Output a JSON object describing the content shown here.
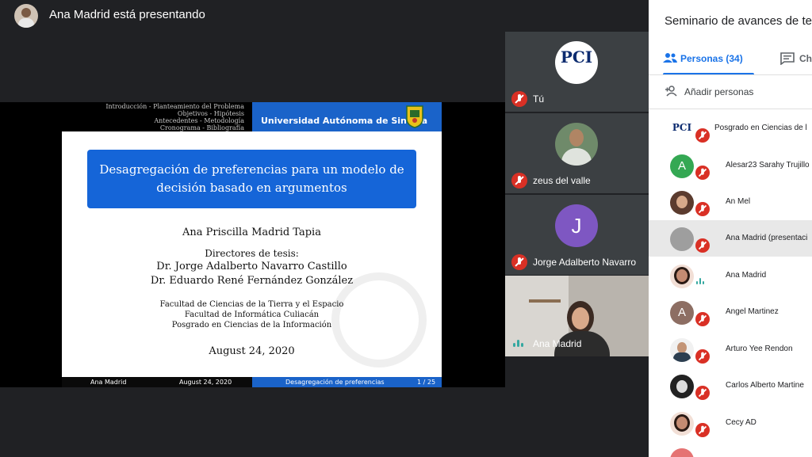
{
  "presenter": {
    "title": "Ana Madrid está presentando"
  },
  "slide": {
    "nav_lines": [
      "Introducción - Planteamiento del Problema",
      "Objetivos - Hipótesis",
      "Antecedentes - Metodología",
      "Cronograma - Bibliografía"
    ],
    "header_university": "Universidad Autónoma de Sinaloa",
    "title_line1": "Desagregación de preferencias para un modelo de",
    "title_line2": "decisión basado en argumentos",
    "author": "Ana Priscilla Madrid Tapia",
    "directors_label": "Directores de tesis:",
    "director1": "Dr. Jorge Adalberto Navarro Castillo",
    "director2": "Dr. Eduardo René Fernández González",
    "faculty1": "Facultad de Ciencias de la Tierra y el Espacio",
    "faculty2": "Facultad de Informática Culiacán",
    "faculty3": "Posgrado en Ciencias de la Información",
    "date": "August 24, 2020",
    "footer_author": "Ana Madrid",
    "footer_date": "August 24, 2020",
    "footer_title": "Desagregación de preferencias",
    "footer_page": "1 / 25"
  },
  "tiles": [
    {
      "name": "Tú",
      "avatar": "PCI"
    },
    {
      "name": "zeus del valle"
    },
    {
      "name": "Jorge Adalberto Navarro",
      "initial": "J"
    },
    {
      "name": "Ana Madrid"
    }
  ],
  "panel": {
    "title": "Seminario de avances de te",
    "tab_people": "Personas (34)",
    "tab_chat": "Ch",
    "add_people": "Añadir personas",
    "people": [
      {
        "name": "Posgrado en Ciencias de l",
        "avatar": "PCI"
      },
      {
        "name": "Alesar23 Sarahy Trujillo",
        "initial": "A"
      },
      {
        "name": "An Mel"
      },
      {
        "name": "Ana Madrid (presentaci"
      },
      {
        "name": "Ana Madrid"
      },
      {
        "name": "Angel Martinez",
        "initial": "A"
      },
      {
        "name": "Arturo Yee Rendon"
      },
      {
        "name": "Carlos Alberto Martine"
      },
      {
        "name": "Cecy AD"
      }
    ]
  },
  "colors": {
    "meet_dark": "#202124",
    "tile_bg": "#3c4043",
    "mic_off_red": "#d93025",
    "beamer_blue": "#1565d8",
    "google_blue": "#1a73e8"
  }
}
